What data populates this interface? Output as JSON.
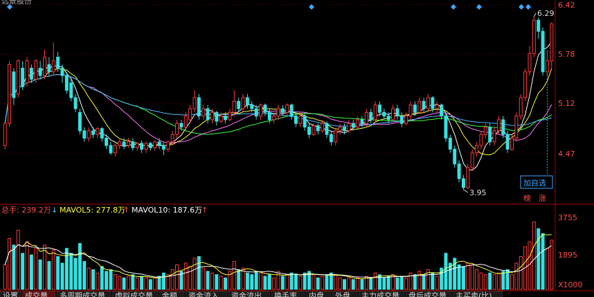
{
  "header": {
    "title": "远景股份"
  },
  "colors": {
    "background": "#000000",
    "up": "#ff3b3b",
    "down": "#37e0e0",
    "grid": "#b00000",
    "axis_price": "#ff4c4c",
    "ma5": "#ffffff",
    "ma10": "#ffff40",
    "ma20": "#ff77ff",
    "ma30": "#40ff40",
    "ma60": "#50b8ff",
    "marker": "#3da8ff"
  },
  "price_axis": {
    "ticks": [
      "6.42",
      "5.78",
      "5.12",
      "4.47"
    ]
  },
  "volume_axis": {
    "ticks": [
      "3755",
      "1895"
    ],
    "unit": "X1000"
  },
  "annotations": {
    "high": "6.29",
    "low": "3.95",
    "add_watchlist": "加自选",
    "badge_bang": "榜",
    "badge_zhang": "涨"
  },
  "volume_header": {
    "total": "总手: 239.2万",
    "mavol5": "MAVOL5: 277.8万",
    "mavol10": "MAVOL10: 187.6万"
  },
  "tabs": [
    "设置",
    "成交量",
    "多周期成交量",
    "虚拟成交量",
    "金额",
    "资金流入",
    "资金流出",
    "换手率",
    "内盘",
    "外盘",
    "主力成交量",
    "盘后成交量",
    "主买卖(比)"
  ],
  "chart_data": {
    "type": "candlestick",
    "price_range": [
      3.8,
      6.45
    ],
    "volume_range": [
      0,
      4300
    ],
    "candles": [
      {
        "o": 4.55,
        "c": 4.85,
        "h": 4.85,
        "l": 4.5,
        "v": 1500
      },
      {
        "o": 4.85,
        "c": 5.65,
        "h": 5.7,
        "l": 4.8,
        "v": 3100
      },
      {
        "o": 5.55,
        "c": 5.2,
        "h": 5.6,
        "l": 5.1,
        "v": 2700
      },
      {
        "o": 5.25,
        "c": 5.7,
        "h": 5.72,
        "l": 5.2,
        "v": 3600
      },
      {
        "o": 5.6,
        "c": 5.35,
        "h": 5.7,
        "l": 5.3,
        "v": 2200
      },
      {
        "o": 5.4,
        "c": 5.7,
        "h": 5.75,
        "l": 5.35,
        "v": 2900
      },
      {
        "o": 5.6,
        "c": 5.45,
        "h": 5.65,
        "l": 5.4,
        "v": 2100
      },
      {
        "o": 5.45,
        "c": 5.7,
        "h": 5.72,
        "l": 5.4,
        "v": 2500
      },
      {
        "o": 5.6,
        "c": 5.5,
        "h": 5.7,
        "l": 5.45,
        "v": 1800
      },
      {
        "o": 5.5,
        "c": 5.75,
        "h": 5.85,
        "l": 5.45,
        "v": 2700
      },
      {
        "o": 5.65,
        "c": 5.55,
        "h": 5.75,
        "l": 5.5,
        "v": 1700
      },
      {
        "o": 5.55,
        "c": 5.7,
        "h": 5.95,
        "l": 5.5,
        "v": 2400
      },
      {
        "o": 5.75,
        "c": 5.6,
        "h": 5.82,
        "l": 5.55,
        "v": 2000
      },
      {
        "o": 5.6,
        "c": 5.5,
        "h": 5.65,
        "l": 5.4,
        "v": 1600
      },
      {
        "o": 5.5,
        "c": 5.3,
        "h": 5.55,
        "l": 5.25,
        "v": 2500
      },
      {
        "o": 5.4,
        "c": 5.2,
        "h": 5.45,
        "l": 5.15,
        "v": 2200
      },
      {
        "o": 5.2,
        "c": 5.05,
        "h": 5.25,
        "l": 5.0,
        "v": 1900
      },
      {
        "o": 5.0,
        "c": 4.75,
        "h": 5.05,
        "l": 4.7,
        "v": 2800
      },
      {
        "o": 4.75,
        "c": 4.65,
        "h": 4.8,
        "l": 4.6,
        "v": 1700
      },
      {
        "o": 4.65,
        "c": 4.75,
        "h": 4.8,
        "l": 4.6,
        "v": 1300
      },
      {
        "o": 4.75,
        "c": 4.7,
        "h": 4.8,
        "l": 4.65,
        "v": 1200
      },
      {
        "o": 4.7,
        "c": 4.78,
        "h": 4.8,
        "l": 4.65,
        "v": 1000
      },
      {
        "o": 4.78,
        "c": 4.65,
        "h": 4.8,
        "l": 4.6,
        "v": 1400
      },
      {
        "o": 4.65,
        "c": 4.55,
        "h": 4.7,
        "l": 4.5,
        "v": 1100
      },
      {
        "o": 4.55,
        "c": 4.45,
        "h": 4.6,
        "l": 4.42,
        "v": 1200
      },
      {
        "o": 4.45,
        "c": 4.55,
        "h": 4.58,
        "l": 4.4,
        "v": 900
      },
      {
        "o": 4.55,
        "c": 4.6,
        "h": 4.65,
        "l": 4.5,
        "v": 800
      },
      {
        "o": 4.6,
        "c": 4.55,
        "h": 4.65,
        "l": 4.5,
        "v": 700
      },
      {
        "o": 4.55,
        "c": 4.6,
        "h": 4.65,
        "l": 4.52,
        "v": 800
      },
      {
        "o": 4.6,
        "c": 4.52,
        "h": 4.65,
        "l": 4.48,
        "v": 900
      },
      {
        "o": 4.52,
        "c": 4.58,
        "h": 4.6,
        "l": 4.48,
        "v": 700
      },
      {
        "o": 4.58,
        "c": 4.5,
        "h": 4.62,
        "l": 4.45,
        "v": 800
      },
      {
        "o": 4.5,
        "c": 4.58,
        "h": 4.6,
        "l": 4.45,
        "v": 700
      },
      {
        "o": 4.58,
        "c": 4.52,
        "h": 4.6,
        "l": 4.48,
        "v": 600
      },
      {
        "o": 4.52,
        "c": 4.6,
        "h": 4.62,
        "l": 4.48,
        "v": 700
      },
      {
        "o": 4.6,
        "c": 4.55,
        "h": 4.65,
        "l": 4.5,
        "v": 800
      },
      {
        "o": 4.55,
        "c": 4.5,
        "h": 4.6,
        "l": 4.42,
        "v": 1000
      },
      {
        "o": 4.5,
        "c": 4.6,
        "h": 4.62,
        "l": 4.46,
        "v": 900
      },
      {
        "o": 4.6,
        "c": 4.7,
        "h": 4.75,
        "l": 4.55,
        "v": 1200
      },
      {
        "o": 4.7,
        "c": 4.85,
        "h": 4.9,
        "l": 4.65,
        "v": 1500
      },
      {
        "o": 4.85,
        "c": 4.8,
        "h": 4.9,
        "l": 4.75,
        "v": 1100
      },
      {
        "o": 4.8,
        "c": 4.95,
        "h": 5.0,
        "l": 4.75,
        "v": 1600
      },
      {
        "o": 4.9,
        "c": 5.05,
        "h": 5.1,
        "l": 4.85,
        "v": 1400
      },
      {
        "o": 5.05,
        "c": 5.2,
        "h": 5.3,
        "l": 5.0,
        "v": 1900
      },
      {
        "o": 5.2,
        "c": 4.95,
        "h": 5.25,
        "l": 4.9,
        "v": 2000
      },
      {
        "o": 4.95,
        "c": 5.05,
        "h": 5.1,
        "l": 4.9,
        "v": 1300
      },
      {
        "o": 5.05,
        "c": 4.9,
        "h": 5.1,
        "l": 4.85,
        "v": 1100
      },
      {
        "o": 4.9,
        "c": 5.0,
        "h": 5.05,
        "l": 4.85,
        "v": 1000
      },
      {
        "o": 5.0,
        "c": 4.88,
        "h": 5.02,
        "l": 4.82,
        "v": 900
      },
      {
        "o": 4.88,
        "c": 4.95,
        "h": 5.0,
        "l": 4.85,
        "v": 800
      },
      {
        "o": 4.95,
        "c": 4.9,
        "h": 5.0,
        "l": 4.85,
        "v": 700
      },
      {
        "o": 4.9,
        "c": 5.0,
        "h": 5.05,
        "l": 4.88,
        "v": 1100
      },
      {
        "o": 5.0,
        "c": 5.15,
        "h": 5.3,
        "l": 4.95,
        "v": 1700
      },
      {
        "o": 5.15,
        "c": 5.05,
        "h": 5.2,
        "l": 5.0,
        "v": 1200
      },
      {
        "o": 5.05,
        "c": 5.2,
        "h": 5.25,
        "l": 5.0,
        "v": 1300
      },
      {
        "o": 5.2,
        "c": 5.1,
        "h": 5.25,
        "l": 5.05,
        "v": 1000
      },
      {
        "o": 5.1,
        "c": 5.05,
        "h": 5.15,
        "l": 5.0,
        "v": 900
      },
      {
        "o": 5.05,
        "c": 4.95,
        "h": 5.1,
        "l": 4.9,
        "v": 1100
      },
      {
        "o": 4.95,
        "c": 5.1,
        "h": 5.12,
        "l": 4.9,
        "v": 1000
      },
      {
        "o": 5.1,
        "c": 5.0,
        "h": 5.12,
        "l": 4.95,
        "v": 800
      },
      {
        "o": 5.0,
        "c": 4.9,
        "h": 5.05,
        "l": 4.85,
        "v": 900
      },
      {
        "o": 4.9,
        "c": 4.95,
        "h": 5.0,
        "l": 4.85,
        "v": 700
      },
      {
        "o": 4.95,
        "c": 5.05,
        "h": 5.1,
        "l": 4.9,
        "v": 1100
      },
      {
        "o": 5.05,
        "c": 5.0,
        "h": 5.1,
        "l": 4.95,
        "v": 800
      },
      {
        "o": 5.0,
        "c": 5.1,
        "h": 5.12,
        "l": 4.95,
        "v": 900
      },
      {
        "o": 5.1,
        "c": 4.95,
        "h": 5.12,
        "l": 4.9,
        "v": 1000
      },
      {
        "o": 4.95,
        "c": 4.85,
        "h": 5.0,
        "l": 4.8,
        "v": 900
      },
      {
        "o": 4.85,
        "c": 4.95,
        "h": 5.0,
        "l": 4.8,
        "v": 800
      },
      {
        "o": 4.95,
        "c": 4.8,
        "h": 5.0,
        "l": 4.75,
        "v": 1000
      },
      {
        "o": 4.8,
        "c": 4.7,
        "h": 4.85,
        "l": 4.65,
        "v": 1100
      },
      {
        "o": 4.7,
        "c": 4.82,
        "h": 4.85,
        "l": 4.68,
        "v": 900
      },
      {
        "o": 4.82,
        "c": 4.75,
        "h": 4.85,
        "l": 4.7,
        "v": 700
      },
      {
        "o": 4.75,
        "c": 4.85,
        "h": 4.9,
        "l": 4.72,
        "v": 800
      },
      {
        "o": 4.85,
        "c": 4.7,
        "h": 4.88,
        "l": 4.65,
        "v": 900
      },
      {
        "o": 4.7,
        "c": 4.6,
        "h": 4.75,
        "l": 4.55,
        "v": 1000
      },
      {
        "o": 4.6,
        "c": 4.75,
        "h": 4.78,
        "l": 4.55,
        "v": 900
      },
      {
        "o": 4.75,
        "c": 4.8,
        "h": 4.85,
        "l": 4.7,
        "v": 700
      },
      {
        "o": 4.8,
        "c": 4.75,
        "h": 4.85,
        "l": 4.7,
        "v": 600
      },
      {
        "o": 4.75,
        "c": 4.85,
        "h": 4.9,
        "l": 4.72,
        "v": 700
      },
      {
        "o": 4.85,
        "c": 4.8,
        "h": 4.9,
        "l": 4.75,
        "v": 600
      },
      {
        "o": 4.8,
        "c": 4.9,
        "h": 4.95,
        "l": 4.78,
        "v": 700
      },
      {
        "o": 4.9,
        "c": 4.85,
        "h": 4.95,
        "l": 4.8,
        "v": 600
      },
      {
        "o": 4.85,
        "c": 5.0,
        "h": 5.05,
        "l": 4.8,
        "v": 800
      },
      {
        "o": 5.0,
        "c": 4.9,
        "h": 5.05,
        "l": 4.85,
        "v": 700
      },
      {
        "o": 4.9,
        "c": 5.1,
        "h": 5.15,
        "l": 4.88,
        "v": 1000
      },
      {
        "o": 5.1,
        "c": 5.0,
        "h": 5.15,
        "l": 4.95,
        "v": 900
      },
      {
        "o": 5.0,
        "c": 4.95,
        "h": 5.05,
        "l": 4.9,
        "v": 700
      },
      {
        "o": 4.95,
        "c": 4.9,
        "h": 5.0,
        "l": 4.85,
        "v": 800
      },
      {
        "o": 4.9,
        "c": 5.05,
        "h": 5.1,
        "l": 4.88,
        "v": 900
      },
      {
        "o": 5.05,
        "c": 4.95,
        "h": 5.1,
        "l": 4.9,
        "v": 700
      },
      {
        "o": 4.95,
        "c": 4.85,
        "h": 5.0,
        "l": 4.8,
        "v": 800
      },
      {
        "o": 4.85,
        "c": 4.95,
        "h": 5.0,
        "l": 4.82,
        "v": 700
      },
      {
        "o": 4.95,
        "c": 5.1,
        "h": 5.15,
        "l": 4.9,
        "v": 1000
      },
      {
        "o": 5.1,
        "c": 5.0,
        "h": 5.15,
        "l": 4.95,
        "v": 900
      },
      {
        "o": 5.0,
        "c": 5.15,
        "h": 5.2,
        "l": 4.98,
        "v": 1100
      },
      {
        "o": 5.15,
        "c": 5.05,
        "h": 5.2,
        "l": 5.0,
        "v": 900
      },
      {
        "o": 5.05,
        "c": 5.2,
        "h": 5.25,
        "l": 5.0,
        "v": 1200
      },
      {
        "o": 5.2,
        "c": 5.05,
        "h": 5.22,
        "l": 5.0,
        "v": 1000
      },
      {
        "o": 5.05,
        "c": 5.1,
        "h": 5.15,
        "l": 5.0,
        "v": 800
      },
      {
        "o": 5.1,
        "c": 4.95,
        "h": 5.12,
        "l": 4.9,
        "v": 1300
      },
      {
        "o": 4.95,
        "c": 4.65,
        "h": 5.0,
        "l": 4.6,
        "v": 2200
      },
      {
        "o": 4.65,
        "c": 4.5,
        "h": 4.7,
        "l": 4.45,
        "v": 1600
      },
      {
        "o": 4.5,
        "c": 4.3,
        "h": 4.55,
        "l": 4.25,
        "v": 1900
      },
      {
        "o": 4.3,
        "c": 4.1,
        "h": 4.35,
        "l": 4.05,
        "v": 1500
      },
      {
        "o": 4.1,
        "c": 3.98,
        "h": 4.15,
        "l": 3.95,
        "v": 1400
      },
      {
        "o": 3.98,
        "c": 4.25,
        "h": 4.3,
        "l": 3.96,
        "v": 1600
      },
      {
        "o": 4.25,
        "c": 4.45,
        "h": 4.5,
        "l": 4.2,
        "v": 1500
      },
      {
        "o": 4.45,
        "c": 4.55,
        "h": 4.6,
        "l": 4.4,
        "v": 1200
      },
      {
        "o": 4.55,
        "c": 4.7,
        "h": 4.75,
        "l": 4.5,
        "v": 1000
      },
      {
        "o": 4.7,
        "c": 4.8,
        "h": 4.85,
        "l": 4.65,
        "v": 900
      },
      {
        "o": 4.8,
        "c": 4.6,
        "h": 4.85,
        "l": 4.55,
        "v": 1000
      },
      {
        "o": 4.6,
        "c": 4.75,
        "h": 4.8,
        "l": 4.55,
        "v": 900
      },
      {
        "o": 4.75,
        "c": 4.9,
        "h": 4.95,
        "l": 4.7,
        "v": 1000
      },
      {
        "o": 4.9,
        "c": 4.7,
        "h": 4.95,
        "l": 4.65,
        "v": 1100
      },
      {
        "o": 4.7,
        "c": 4.5,
        "h": 4.75,
        "l": 4.45,
        "v": 1200
      },
      {
        "o": 4.5,
        "c": 4.65,
        "h": 4.7,
        "l": 4.48,
        "v": 900
      },
      {
        "o": 4.65,
        "c": 4.95,
        "h": 5.0,
        "l": 4.6,
        "v": 1600
      },
      {
        "o": 4.95,
        "c": 5.2,
        "h": 5.25,
        "l": 4.9,
        "v": 2000
      },
      {
        "o": 5.2,
        "c": 5.55,
        "h": 5.6,
        "l": 5.15,
        "v": 2600
      },
      {
        "o": 5.55,
        "c": 5.8,
        "h": 5.9,
        "l": 5.5,
        "v": 2900
      },
      {
        "o": 5.8,
        "c": 6.25,
        "h": 6.3,
        "l": 5.75,
        "v": 4100
      },
      {
        "o": 6.25,
        "c": 6.1,
        "h": 6.29,
        "l": 6.0,
        "v": 3700
      },
      {
        "o": 6.1,
        "c": 5.55,
        "h": 6.15,
        "l": 5.5,
        "v": 3400
      },
      {
        "o": 5.55,
        "c": 5.7,
        "h": 5.85,
        "l": 5.5,
        "v": 2500
      },
      {
        "o": 5.7,
        "c": 6.2,
        "h": 6.22,
        "l": 5.6,
        "v": 3000
      }
    ]
  }
}
